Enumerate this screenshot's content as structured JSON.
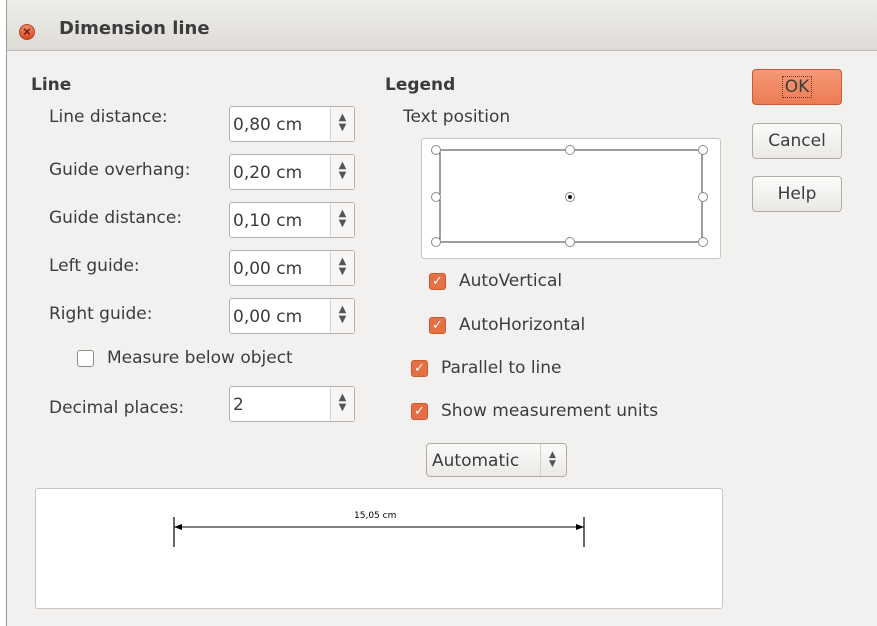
{
  "window": {
    "title": "Dimension line"
  },
  "line": {
    "heading": "Line",
    "fields": [
      {
        "label": "Line distance:",
        "value": "0,80 cm"
      },
      {
        "label": "Guide overhang:",
        "value": "0,20 cm"
      },
      {
        "label": "Guide distance:",
        "value": "0,10 cm"
      },
      {
        "label": "Left guide:",
        "value": "0,00 cm"
      },
      {
        "label": "Right guide:",
        "value": "0,00 cm"
      }
    ],
    "measure_below": {
      "label": "Measure below object",
      "checked": false
    },
    "decimal": {
      "label": "Decimal places:",
      "value": "2"
    }
  },
  "legend": {
    "heading": "Legend",
    "text_position_label": "Text position",
    "auto_vertical": {
      "label": "AutoVertical",
      "checked": true
    },
    "auto_horizontal": {
      "label": "AutoHorizontal",
      "checked": true
    },
    "parallel": {
      "label": "Parallel to line",
      "checked": true
    },
    "show_units": {
      "label": "Show measurement units",
      "checked": true
    },
    "units_select": "Automatic"
  },
  "buttons": {
    "ok": "OK",
    "cancel": "Cancel",
    "help": "Help"
  },
  "preview": {
    "measurement": "15,05 cm"
  },
  "colors": {
    "accent": "#e57044",
    "default_button": "#ec7b53"
  }
}
